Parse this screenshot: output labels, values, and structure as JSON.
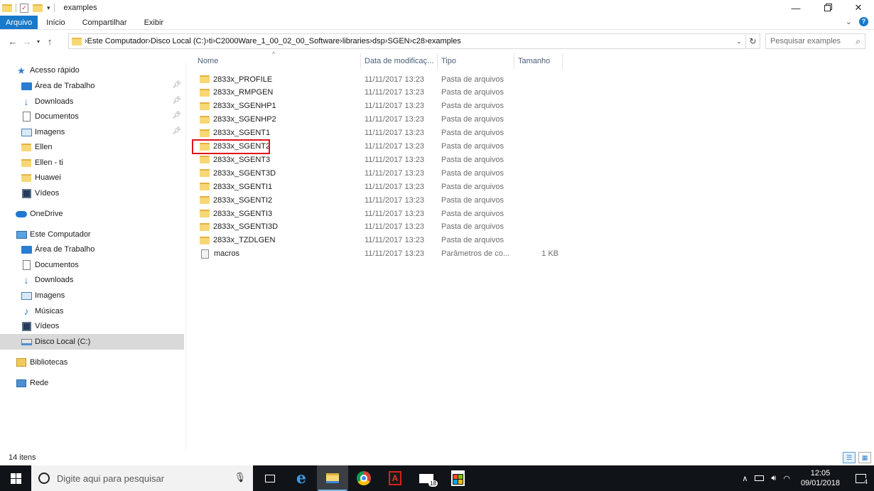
{
  "window": {
    "title": "examples"
  },
  "ribbon": {
    "file": "Arquivo",
    "tabs": [
      "Início",
      "Compartilhar",
      "Exibir"
    ]
  },
  "address": {
    "crumbs": [
      "Este Computador",
      "Disco Local (C:)",
      "ti",
      "C2000Ware_1_00_02_00_Software",
      "libraries",
      "dsp",
      "SGEN",
      "c28",
      "examples"
    ]
  },
  "search": {
    "placeholder": "Pesquisar examples"
  },
  "nav": {
    "items": [
      {
        "label": "Acesso rápido",
        "icon": "star-icon",
        "level": "top"
      },
      {
        "label": "Área de Trabalho",
        "icon": "desktop-icon",
        "level": "sub",
        "pinned": true
      },
      {
        "label": "Downloads",
        "icon": "download-icon",
        "level": "sub",
        "pinned": true
      },
      {
        "label": "Documentos",
        "icon": "document-icon",
        "level": "sub",
        "pinned": true
      },
      {
        "label": "Imagens",
        "icon": "pictures-icon",
        "level": "sub",
        "pinned": true
      },
      {
        "label": "Ellen",
        "icon": "folder-icon",
        "level": "sub"
      },
      {
        "label": "Ellen - ti",
        "icon": "folder-icon",
        "level": "sub"
      },
      {
        "label": "Huawei",
        "icon": "folder-icon",
        "level": "sub"
      },
      {
        "label": "Vídeos",
        "icon": "videos-icon",
        "level": "sub"
      },
      {
        "label": "OneDrive",
        "icon": "onedrive-icon",
        "level": "top"
      },
      {
        "label": "Este Computador",
        "icon": "computer-icon",
        "level": "top"
      },
      {
        "label": "Área de Trabalho",
        "icon": "desktop-icon",
        "level": "sub"
      },
      {
        "label": "Documentos",
        "icon": "document-icon",
        "level": "sub"
      },
      {
        "label": "Downloads",
        "icon": "download-icon",
        "level": "sub"
      },
      {
        "label": "Imagens",
        "icon": "pictures-icon",
        "level": "sub"
      },
      {
        "label": "Músicas",
        "icon": "music-icon",
        "level": "sub"
      },
      {
        "label": "Vídeos",
        "icon": "videos-icon",
        "level": "sub"
      },
      {
        "label": "Disco Local (C:)",
        "icon": "drive-icon",
        "level": "sub",
        "selected": true
      },
      {
        "label": "Bibliotecas",
        "icon": "libraries-icon",
        "level": "top"
      },
      {
        "label": "Rede",
        "icon": "network-icon",
        "level": "top"
      }
    ]
  },
  "columns": {
    "name": "Nome",
    "date": "Data de modificaç...",
    "type": "Tipo",
    "size": "Tamanho"
  },
  "files": [
    {
      "name": "2833x_PROFILE",
      "date": "11/11/2017 13:23",
      "type": "Pasta de arquivos",
      "size": "",
      "kind": "folder"
    },
    {
      "name": "2833x_RMPGEN",
      "date": "11/11/2017 13:23",
      "type": "Pasta de arquivos",
      "size": "",
      "kind": "folder"
    },
    {
      "name": "2833x_SGENHP1",
      "date": "11/11/2017 13:23",
      "type": "Pasta de arquivos",
      "size": "",
      "kind": "folder"
    },
    {
      "name": "2833x_SGENHP2",
      "date": "11/11/2017 13:23",
      "type": "Pasta de arquivos",
      "size": "",
      "kind": "folder"
    },
    {
      "name": "2833x_SGENT1",
      "date": "11/11/2017 13:23",
      "type": "Pasta de arquivos",
      "size": "",
      "kind": "folder"
    },
    {
      "name": "2833x_SGENT2",
      "date": "11/11/2017 13:23",
      "type": "Pasta de arquivos",
      "size": "",
      "kind": "folder",
      "highlighted": true
    },
    {
      "name": "2833x_SGENT3",
      "date": "11/11/2017 13:23",
      "type": "Pasta de arquivos",
      "size": "",
      "kind": "folder"
    },
    {
      "name": "2833x_SGENT3D",
      "date": "11/11/2017 13:23",
      "type": "Pasta de arquivos",
      "size": "",
      "kind": "folder"
    },
    {
      "name": "2833x_SGENTI1",
      "date": "11/11/2017 13:23",
      "type": "Pasta de arquivos",
      "size": "",
      "kind": "folder"
    },
    {
      "name": "2833x_SGENTI2",
      "date": "11/11/2017 13:23",
      "type": "Pasta de arquivos",
      "size": "",
      "kind": "folder"
    },
    {
      "name": "2833x_SGENTI3",
      "date": "11/11/2017 13:23",
      "type": "Pasta de arquivos",
      "size": "",
      "kind": "folder"
    },
    {
      "name": "2833x_SGENTI3D",
      "date": "11/11/2017 13:23",
      "type": "Pasta de arquivos",
      "size": "",
      "kind": "folder"
    },
    {
      "name": "2833x_TZDLGEN",
      "date": "11/11/2017 13:23",
      "type": "Pasta de arquivos",
      "size": "",
      "kind": "folder"
    },
    {
      "name": "macros",
      "date": "11/11/2017 13:23",
      "type": "Parâmetros de co...",
      "size": "1 KB",
      "kind": "file"
    }
  ],
  "status": {
    "count": "14 itens"
  },
  "taskbar": {
    "search_placeholder": "Digite aqui para pesquisar",
    "mail_badge": "18",
    "notif_badge": "4",
    "time": "12:05",
    "date": "09/01/2018"
  },
  "colors": {
    "accent": "#1979ca",
    "highlight": "#e0121b",
    "taskbar": "#101418"
  }
}
